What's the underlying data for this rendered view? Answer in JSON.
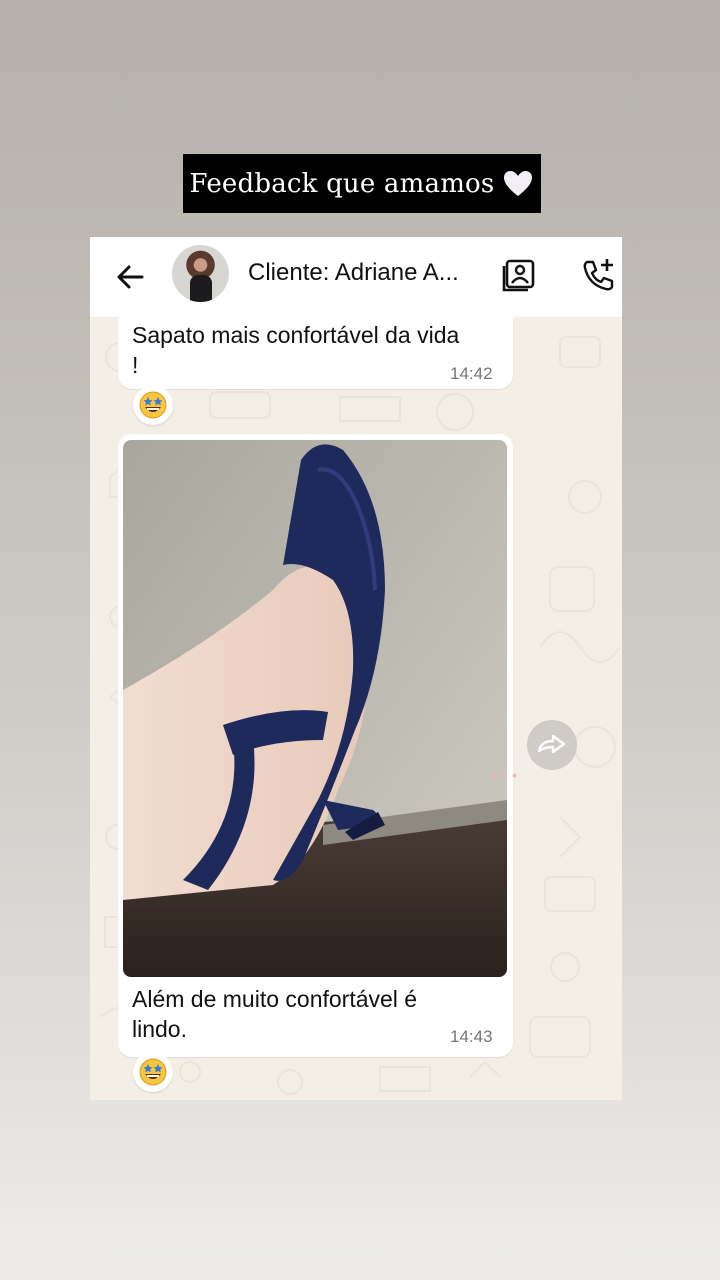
{
  "story": {
    "title": "Feedback que amamos",
    "heart_icon": "white-heart-icon"
  },
  "chat": {
    "header": {
      "back_icon": "arrow-left-icon",
      "contact_name": "Cliente: Adriane A...",
      "catalog_icon": "contacts-book-icon",
      "call_icon": "add-call-icon"
    },
    "messages": [
      {
        "text": "Sapato mais confortável da vida !",
        "time": "14:42",
        "reaction": "star-struck-emoji"
      },
      {
        "media": "photo of navy blue slingback heel on foot",
        "text": "Além de muito confortável é lindo.",
        "time": "14:43",
        "reaction": "star-struck-emoji"
      }
    ],
    "forward_icon": "forward-arrow-icon",
    "colors": {
      "bubble": "#ffffff",
      "background": "#f3efe7",
      "shoe": "#1f2a5c"
    }
  }
}
